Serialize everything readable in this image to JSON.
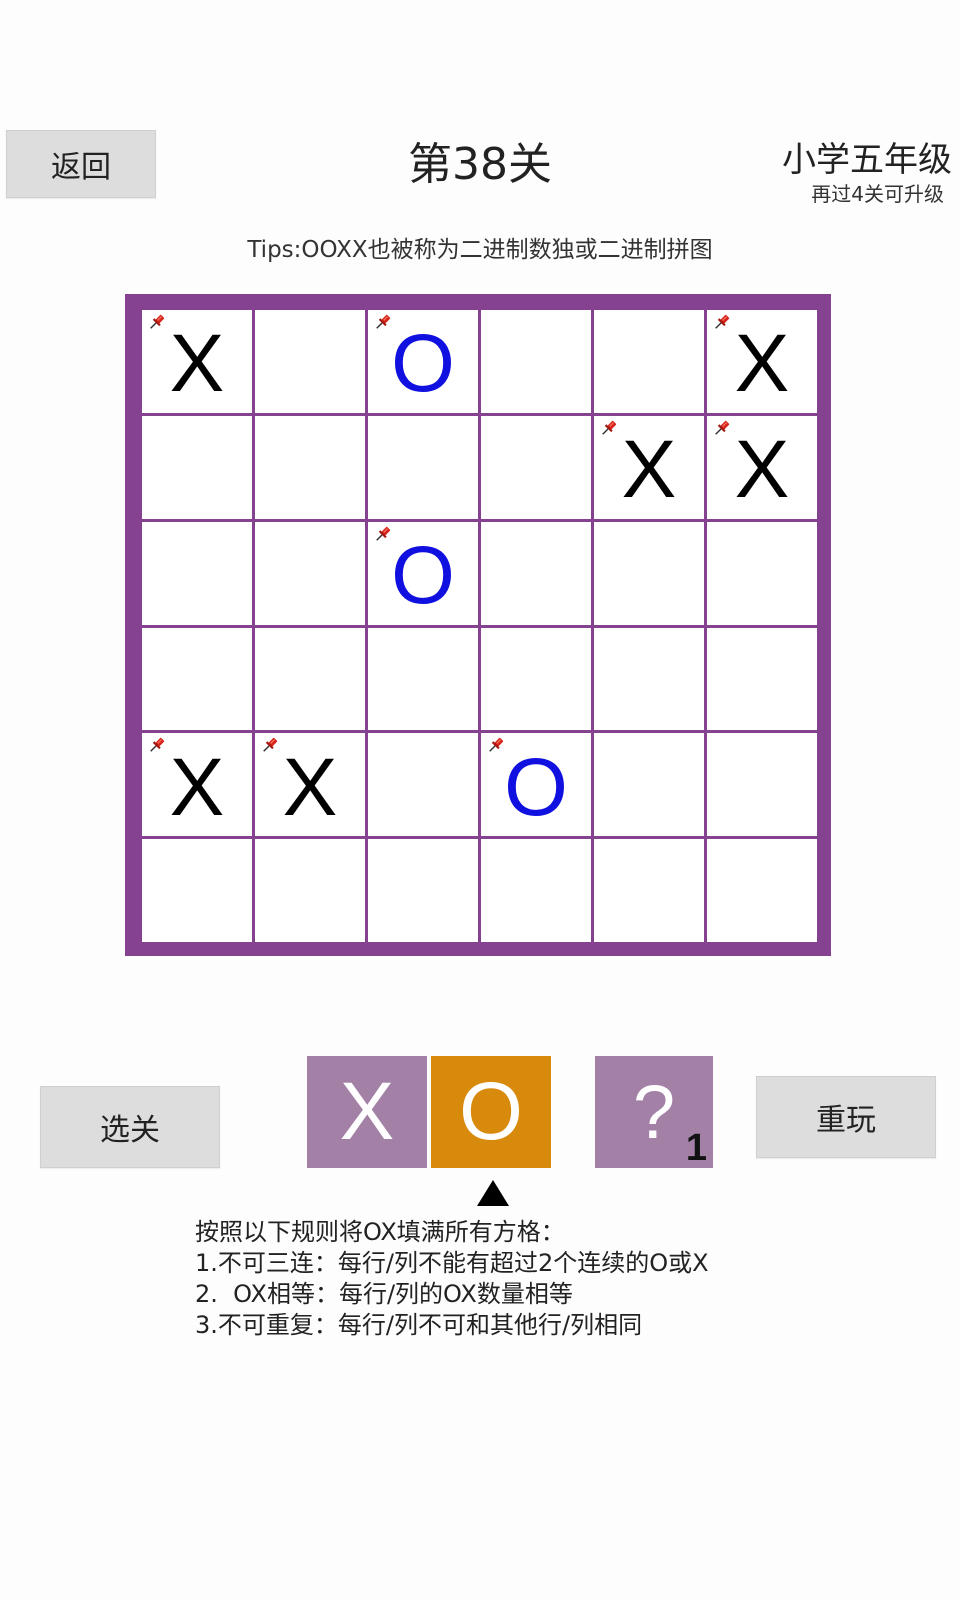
{
  "header": {
    "back_label": "返回",
    "level_title": "第38关",
    "grade": "小学五年级",
    "upgrade_hint": "再过4关可升级",
    "tips": "Tips:OOXX也被称为二进制数独或二进制拼图"
  },
  "board": {
    "rows": 6,
    "cols": 6,
    "cells": [
      [
        {
          "v": "X",
          "fixed": true
        },
        {
          "v": "",
          "fixed": false
        },
        {
          "v": "O",
          "fixed": true
        },
        {
          "v": "",
          "fixed": false
        },
        {
          "v": "",
          "fixed": false
        },
        {
          "v": "X",
          "fixed": true
        }
      ],
      [
        {
          "v": "",
          "fixed": false
        },
        {
          "v": "",
          "fixed": false
        },
        {
          "v": "",
          "fixed": false
        },
        {
          "v": "",
          "fixed": false
        },
        {
          "v": "X",
          "fixed": true
        },
        {
          "v": "X",
          "fixed": true
        }
      ],
      [
        {
          "v": "",
          "fixed": false
        },
        {
          "v": "",
          "fixed": false
        },
        {
          "v": "O",
          "fixed": true
        },
        {
          "v": "",
          "fixed": false
        },
        {
          "v": "",
          "fixed": false
        },
        {
          "v": "",
          "fixed": false
        }
      ],
      [
        {
          "v": "",
          "fixed": false
        },
        {
          "v": "",
          "fixed": false
        },
        {
          "v": "",
          "fixed": false
        },
        {
          "v": "",
          "fixed": false
        },
        {
          "v": "",
          "fixed": false
        },
        {
          "v": "",
          "fixed": false
        }
      ],
      [
        {
          "v": "X",
          "fixed": true
        },
        {
          "v": "X",
          "fixed": true
        },
        {
          "v": "",
          "fixed": false
        },
        {
          "v": "O",
          "fixed": true
        },
        {
          "v": "",
          "fixed": false
        },
        {
          "v": "",
          "fixed": false
        }
      ],
      [
        {
          "v": "",
          "fixed": false
        },
        {
          "v": "",
          "fixed": false
        },
        {
          "v": "",
          "fixed": false
        },
        {
          "v": "",
          "fixed": false
        },
        {
          "v": "",
          "fixed": false
        },
        {
          "v": "",
          "fixed": false
        }
      ]
    ],
    "colors": {
      "border": "#844290",
      "x": "#000000",
      "o": "#1010e0"
    }
  },
  "controls": {
    "select_level_label": "选关",
    "replay_label": "重玩",
    "tool_x": "X",
    "tool_o": "O",
    "selected_tool": "O",
    "hint_symbol": "?",
    "hint_count": "1",
    "colors": {
      "tool": "#a381a6",
      "tool_selected": "#d88a0c"
    }
  },
  "rules": {
    "title": "按照以下规则将OX填满所有方格：",
    "items": [
      "1.不可三连：每行/列不能有超过2个连续的O或X",
      "2.  OX相等：每行/列的OX数量相等",
      "3.不可重复：每行/列不可和其他行/列相同"
    ]
  }
}
